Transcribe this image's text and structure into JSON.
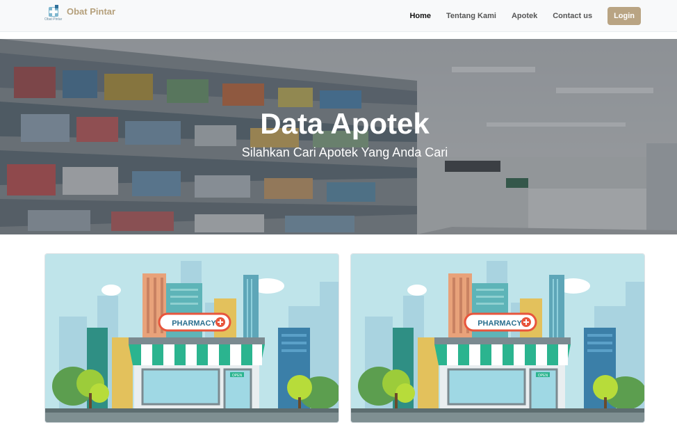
{
  "brand": {
    "name": "Obat Pintar",
    "logo_tagline": "Obat Pintar",
    "icon": "medical-cross-icon"
  },
  "nav": {
    "items": [
      {
        "label": "Home",
        "active": true
      },
      {
        "label": "Tentang Kami",
        "active": false
      },
      {
        "label": "Apotek",
        "active": false
      },
      {
        "label": "Contact us",
        "active": false
      }
    ],
    "login_label": "Login"
  },
  "hero": {
    "title": "Data Apotek",
    "subtitle": "Silahkan Cari Apotek Yang Anda Cari"
  },
  "cards": [
    {
      "sign": "PHARMACY",
      "door_sign": "OPEN"
    },
    {
      "sign": "PHARMACY",
      "door_sign": "OPEN"
    }
  ],
  "colors": {
    "brand": "#b5a07c",
    "login_button": "#b9a483",
    "awning": "#2bb48f",
    "sign_border": "#e8553c"
  }
}
